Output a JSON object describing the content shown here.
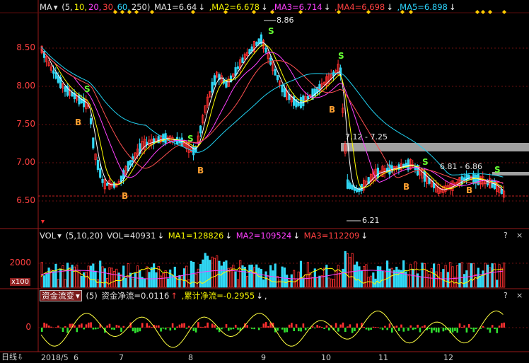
{
  "price_header": {
    "indicator": "MA",
    "params_open": "(5,",
    "p10": "10,",
    "p20": "20,",
    "p30": "30,",
    "p60": "60,",
    "p250": "250)",
    "ma1": "MA1=6.64",
    "ma2": ",MA2=6.678",
    "ma3": ",MA3=6.714",
    "ma4": ",MA4=6.698",
    "ma5": ",MA5=6.898"
  },
  "price_axis": [
    "8.50",
    "8.00",
    "7.50",
    "7.00",
    "6.50"
  ],
  "annotations": {
    "high": "8.86",
    "low": "6.21",
    "range1": "7.12 - 7.25",
    "range2": "6.81 - 6.86"
  },
  "signals": {
    "sell": "S",
    "buy": "B"
  },
  "vol_header": {
    "indicator": "VOL",
    "params": "(5,10,20)",
    "vol": "VOL=40931",
    "ma1": "MA1=128826",
    "ma2": "MA2=109524",
    "ma3": "MA3=112209"
  },
  "vol_axis": {
    "tick": "2000",
    "unit": "x100"
  },
  "flow_header": {
    "indicator": "资金流变",
    "param": "(5)",
    "net": "资金净流=0.0116",
    "cum": ",累计净流=-0.2955"
  },
  "flow_axis": {
    "zero": "0"
  },
  "panel_controls": {
    "help": "?",
    "close": "×"
  },
  "x_axis": {
    "period_label": "日线",
    "labels": [
      "2018/5",
      "6",
      "7",
      "8",
      "9",
      "10",
      "11",
      "12"
    ]
  },
  "colors": {
    "up": "#ff3030",
    "down": "#31d8f5",
    "ma5": "#ffffff",
    "ma10": "#ffff00",
    "ma20": "#ff40ff",
    "ma30": "#ff5050",
    "ma60": "#20d0f0",
    "grid": "#7a1010"
  }
}
